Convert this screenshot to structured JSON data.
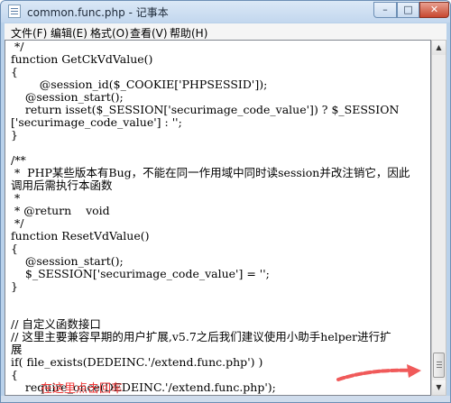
{
  "window": {
    "title": "common.func.php - 记事本",
    "controls": {
      "minimize": "–",
      "maximize": "□",
      "close": "✕"
    }
  },
  "menu": {
    "items": [
      "文件(F)",
      "编辑(E)",
      "格式(O)",
      "查看(V)",
      "帮助(H)"
    ]
  },
  "editor": {
    "lines": [
      " */",
      "function GetCkVdValue()",
      "{",
      "        @session_id($_COOKIE['PHPSESSID']);",
      "    @session_start();",
      "    return isset($_SESSION['securimage_code_value']) ? $_SESSION",
      "['securimage_code_value'] : '';",
      "}",
      "",
      "/**",
      " *  PHP某些版本有Bug，不能在同一作用域中同时读session并改注销它，因此",
      "调用后需执行本函数",
      " *",
      " * @return    void",
      " */",
      "function ResetVdValue()",
      "{",
      "    @session_start();",
      "    $_SESSION['securimage_code_value'] = '';",
      "}",
      "",
      "",
      "// 自定义函数接口",
      "// 这里主要兼容早期的用户扩展,v5.7之后我们建议使用小助手helper进行扩",
      "展",
      "if( file_exists(DEDEINC.'/extend.func.php') )",
      "{",
      "    require_once(DEDEINC.'/extend.func.php');",
      "}"
    ]
  },
  "annotation": {
    "text": "在这里点击回车",
    "color": "#ef3a3a"
  },
  "scrollbar": {
    "up_icon": "▲",
    "down_icon": "▼"
  }
}
